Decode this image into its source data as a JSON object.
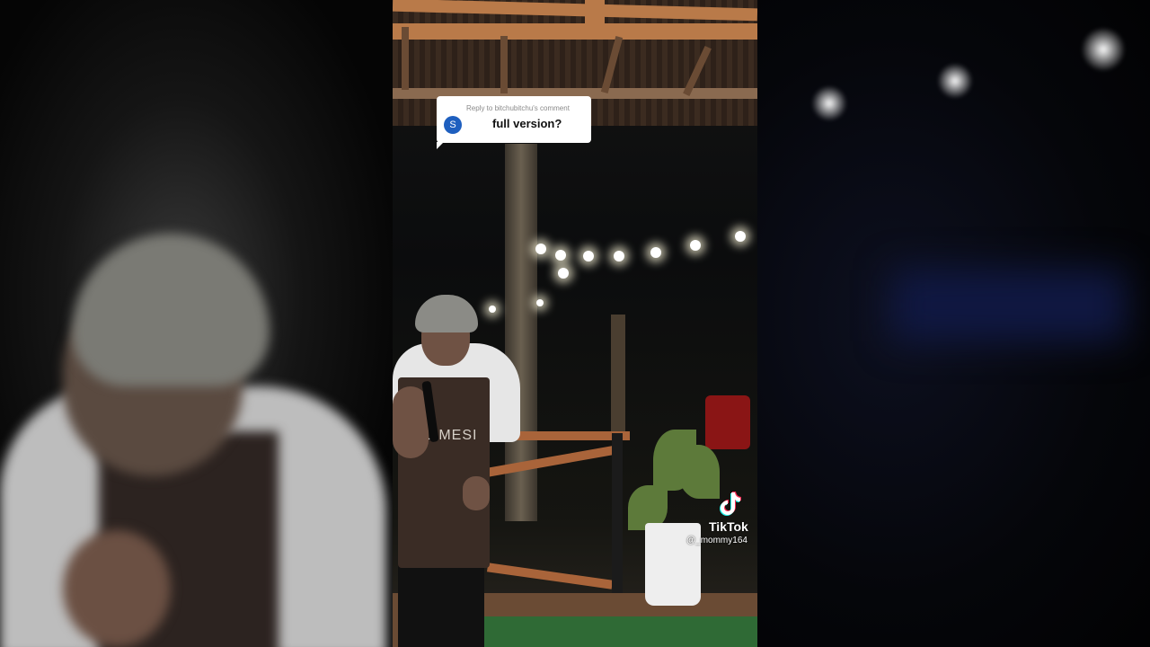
{
  "video": {
    "reply_header": "Reply to bitchubitchu's comment",
    "reply_avatar_letter": "S",
    "reply_text": "full version?",
    "apron_text": "LIMESI",
    "watermark": {
      "name": "TikTok",
      "handle": "@_mommy164"
    }
  },
  "colors": {
    "reply_avatar": "#1e5fbf",
    "beam": "#b97a49",
    "turf": "#2f6a35"
  }
}
